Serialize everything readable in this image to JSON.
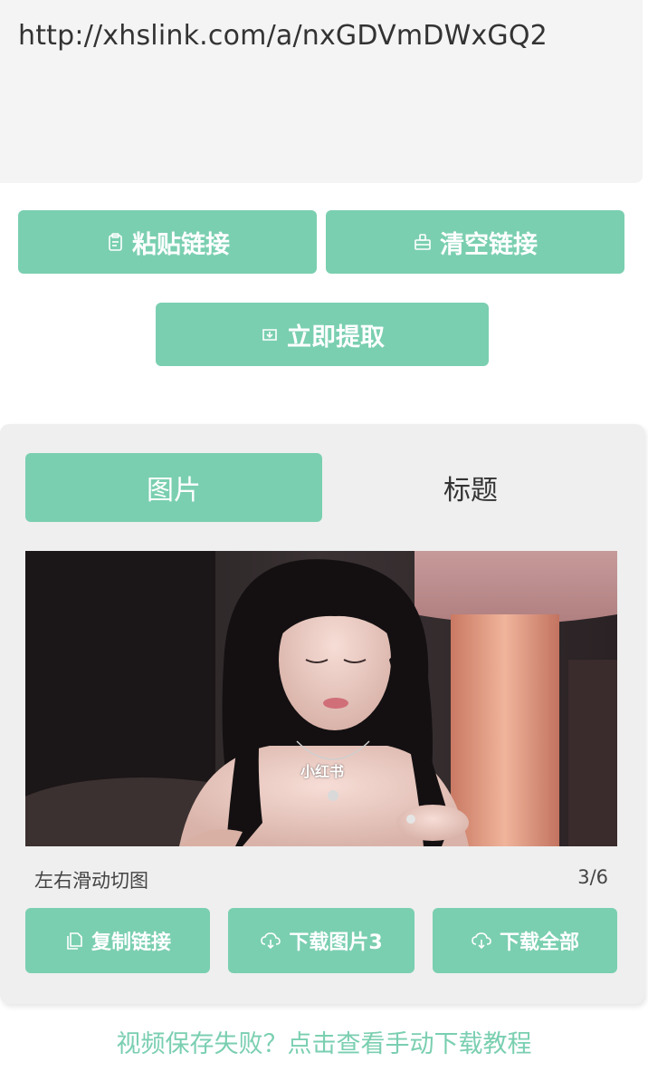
{
  "input": {
    "value": "http://xhslink.com/a/nxGDVmDWxGQ2"
  },
  "actions": {
    "paste_label": "粘贴链接",
    "clear_label": "清空链接",
    "extract_label": "立即提取"
  },
  "result": {
    "tabs": [
      {
        "label": "图片",
        "active": true
      },
      {
        "label": "标题",
        "active": false
      }
    ],
    "image_watermark": "小红书",
    "swipe_hint": "左右滑动切图",
    "counter": "3/6",
    "buttons": {
      "copy_label": "复制链接",
      "download_one_label": "下载图片3",
      "download_all_label": "下载全部"
    }
  },
  "footer": {
    "tutorial_link": "视频保存失败？点击查看手动下载教程"
  },
  "colors": {
    "accent": "#7acfb0",
    "input_bg": "#f4f4f4",
    "panel_bg": "#efefef"
  }
}
